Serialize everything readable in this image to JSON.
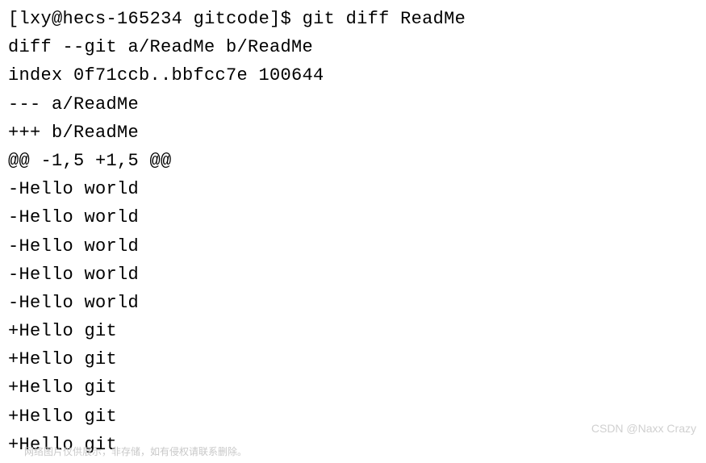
{
  "prompt": {
    "user": "lxy",
    "host": "hecs-165234",
    "cwd": "gitcode",
    "symbol": "$",
    "command": "git diff ReadMe"
  },
  "diff": {
    "header": "diff --git a/ReadMe b/ReadMe",
    "index": "index 0f71ccb..bbfcc7e 100644",
    "from_file": "--- a/ReadMe",
    "to_file": "+++ b/ReadMe",
    "hunk": "@@ -1,5 +1,5 @@",
    "removed": [
      "-Hello world",
      "-Hello world",
      "-Hello world",
      "-Hello world",
      "-Hello world"
    ],
    "added": [
      "+Hello git",
      "+Hello git",
      "+Hello git",
      "+Hello git",
      "+Hello git"
    ]
  },
  "watermark": {
    "right": "CSDN @Naxx Crazy",
    "bottom": "网络图片仅供展示，非存储，如有侵权请联系删除。"
  }
}
